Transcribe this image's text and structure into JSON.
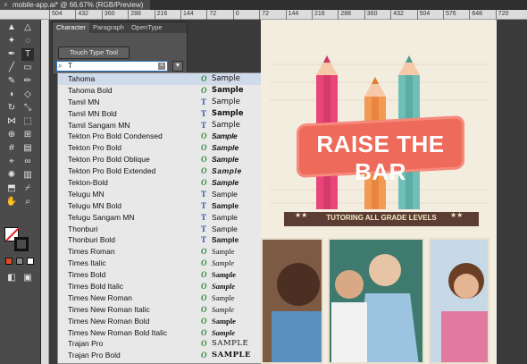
{
  "document": {
    "tab_title": "mobile-app.ai* @ 66.67% (RGB/Preview)"
  },
  "ruler": {
    "ticks": [
      "504",
      "432",
      "360",
      "288",
      "216",
      "144",
      "72",
      "0",
      "72",
      "144",
      "216",
      "288",
      "360",
      "432",
      "504",
      "576",
      "648",
      "720"
    ]
  },
  "character_panel": {
    "tabs": [
      "Character",
      "Paragraph",
      "OpenType"
    ],
    "touch_button_label": "Touch Type Tool",
    "font_search_value": "T"
  },
  "font_list": {
    "items": [
      {
        "name": "Tahoma",
        "type": "ot",
        "type_glyph": "O",
        "sample": "Sample"
      },
      {
        "name": "Tahoma Bold",
        "type": "ot",
        "type_glyph": "O",
        "sample": "Sample"
      },
      {
        "name": "Tamil MN",
        "type": "tt",
        "type_glyph": "T",
        "sample": "Sample"
      },
      {
        "name": "Tamil MN Bold",
        "type": "tt",
        "type_glyph": "T",
        "sample": "Sample"
      },
      {
        "name": "Tamil Sangam MN",
        "type": "tt",
        "type_glyph": "T",
        "sample": "Sample"
      },
      {
        "name": "Tekton Pro Bold Condensed",
        "type": "ot",
        "type_glyph": "O",
        "sample": "Sample"
      },
      {
        "name": "Tekton Pro Bold",
        "type": "ot",
        "type_glyph": "O",
        "sample": "Sample"
      },
      {
        "name": "Tekton Pro Bold Oblique",
        "type": "ot",
        "type_glyph": "O",
        "sample": "Sample"
      },
      {
        "name": "Tekton Pro Bold Extended",
        "type": "ot",
        "type_glyph": "O",
        "sample": "Sample"
      },
      {
        "name": "Tekton-Bold",
        "type": "ot",
        "type_glyph": "O",
        "sample": "Sample"
      },
      {
        "name": "Telugu MN",
        "type": "tt",
        "type_glyph": "T",
        "sample": "Sample"
      },
      {
        "name": "Telugu MN Bold",
        "type": "tt",
        "type_glyph": "T",
        "sample": "Sample"
      },
      {
        "name": "Telugu Sangam MN",
        "type": "tt",
        "type_glyph": "T",
        "sample": "Sample"
      },
      {
        "name": "Thonburi",
        "type": "tt",
        "type_glyph": "T",
        "sample": "Sample"
      },
      {
        "name": "Thonburi Bold",
        "type": "tt",
        "type_glyph": "T",
        "sample": "Sample"
      },
      {
        "name": "Times Roman",
        "type": "ot",
        "type_glyph": "O",
        "sample": "Sample"
      },
      {
        "name": "Times Italic",
        "type": "ot",
        "type_glyph": "O",
        "sample": "Sample"
      },
      {
        "name": "Times Bold",
        "type": "ot",
        "type_glyph": "O",
        "sample": "Sample"
      },
      {
        "name": "Times Bold Italic",
        "type": "ot",
        "type_glyph": "O",
        "sample": "Sample"
      },
      {
        "name": "Times New Roman",
        "type": "ot",
        "type_glyph": "O",
        "sample": "Sample"
      },
      {
        "name": "Times New Roman Italic",
        "type": "ot",
        "type_glyph": "O",
        "sample": "Sample"
      },
      {
        "name": "Times New Roman Bold",
        "type": "ot",
        "type_glyph": "O",
        "sample": "Sample"
      },
      {
        "name": "Times New Roman Bold Italic",
        "type": "ot",
        "type_glyph": "O",
        "sample": "Sample"
      },
      {
        "name": "Trajan Pro",
        "type": "ot",
        "type_glyph": "O",
        "sample": "SAMPLE"
      },
      {
        "name": "Trajan Pro Bold",
        "type": "ot",
        "type_glyph": "O",
        "sample": "SAMPLE"
      }
    ]
  },
  "artboard": {
    "headline": "RAISE THE BAR",
    "ribbon_text": "TUTORING ALL GRADE LEVELS",
    "ribbon_stars": "★★"
  },
  "colors": {
    "pencil_pink": "#e8467a",
    "pencil_orange": "#f29a53",
    "pencil_teal": "#6fbfb6",
    "banner": "#ee6a5a",
    "ribbon": "#5b3d33",
    "artboard_bg": "#f3ede0"
  }
}
